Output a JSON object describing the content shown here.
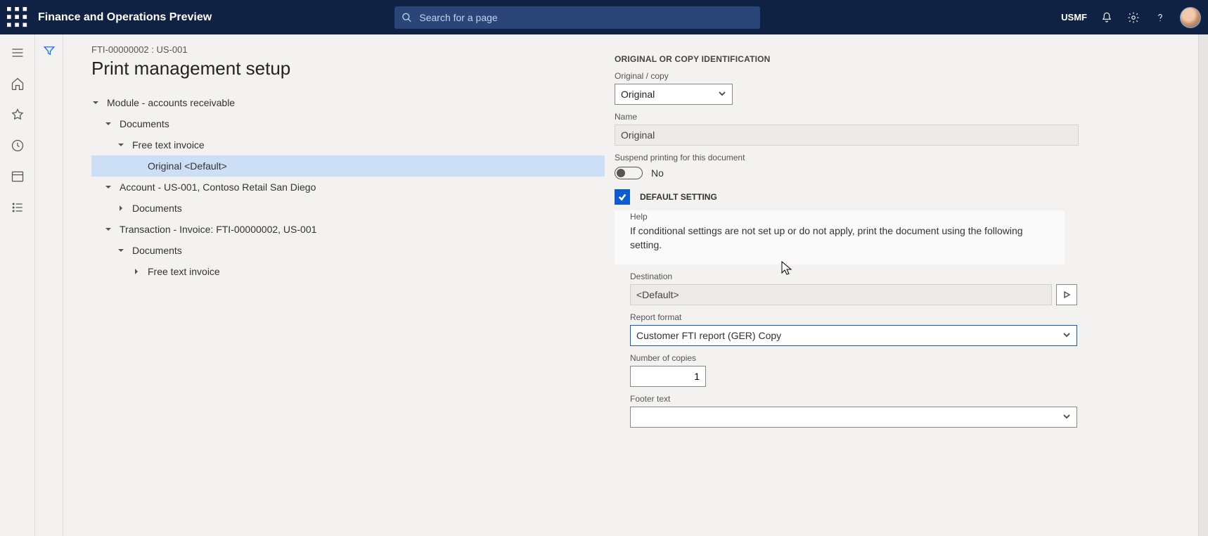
{
  "topbar": {
    "app_title": "Finance and Operations Preview",
    "search_placeholder": "Search for a page",
    "company": "USMF"
  },
  "page": {
    "breadcrumb": "FTI-00000002 : US-001",
    "title": "Print management setup"
  },
  "tree": {
    "n0": "Module - accounts receivable",
    "n1": "Documents",
    "n2": "Free text invoice",
    "n3": "Original <Default>",
    "n4": "Account - US-001, Contoso Retail San Diego",
    "n5": "Documents",
    "n6": "Transaction - Invoice: FTI-00000002, US-001",
    "n7": "Documents",
    "n8": "Free text invoice"
  },
  "form": {
    "section1_title": "ORIGINAL OR COPY IDENTIFICATION",
    "original_copy_label": "Original / copy",
    "original_copy_value": "Original",
    "name_label": "Name",
    "name_value": "Original",
    "suspend_label": "Suspend printing for this document",
    "suspend_value": "No",
    "default_setting_label": "DEFAULT SETTING",
    "help_label": "Help",
    "help_text": "If conditional settings are not set up or do not apply, print the document using the following setting.",
    "destination_label": "Destination",
    "destination_value": "<Default>",
    "report_format_label": "Report format",
    "report_format_value": "Customer FTI report (GER) Copy",
    "copies_label": "Number of copies",
    "copies_value": "1",
    "footer_label": "Footer text"
  }
}
